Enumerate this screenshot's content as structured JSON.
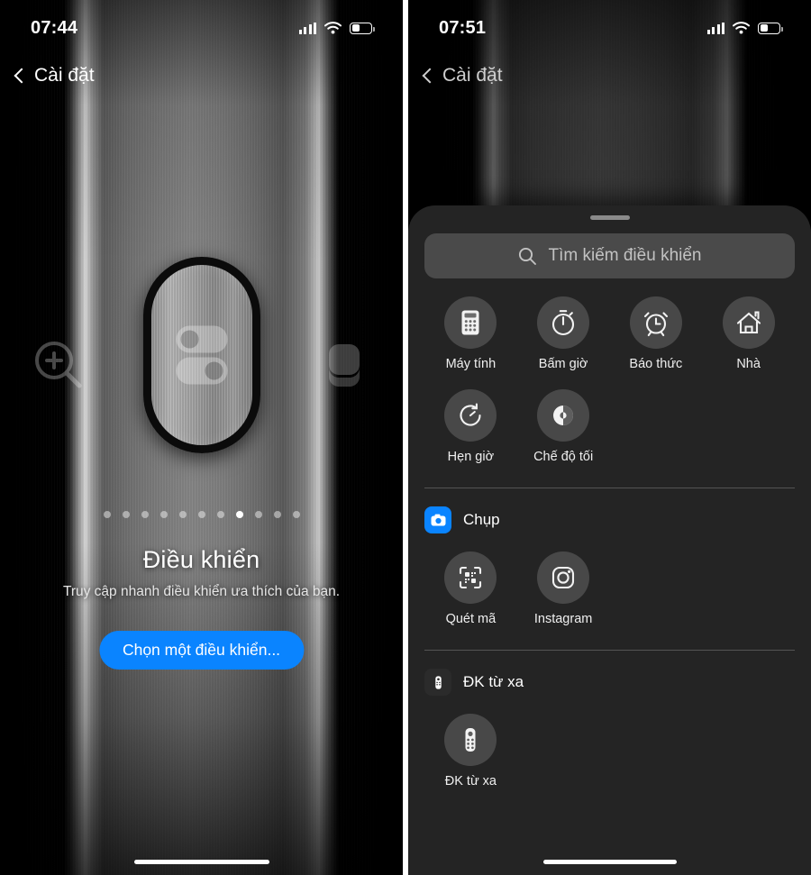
{
  "left": {
    "status": {
      "time": "07:44",
      "signal_icon": "signal-bars-icon",
      "wifi_icon": "wifi-icon",
      "battery_icon": "battery-low-icon"
    },
    "nav": {
      "back_label": "Cài đặt",
      "back_icon": "chevron-left-icon"
    },
    "hero": {
      "capsule_icon": "toggle-switch-icon",
      "left_icon": "zoom-in-icon",
      "right_icon": "layers-icon",
      "title": "Điều khiển",
      "subtitle": "Truy cập nhanh điều khiển ưa thích của bạn.",
      "button_label": "Chọn một điều khiển...",
      "page_dots_total": 11,
      "page_dot_active_index": 7
    }
  },
  "right": {
    "status": {
      "time": "07:51",
      "signal_icon": "signal-bars-icon",
      "wifi_icon": "wifi-icon",
      "battery_icon": "battery-low-icon"
    },
    "nav": {
      "back_label": "Cài đặt",
      "back_icon": "chevron-left-icon"
    },
    "sheet": {
      "grabber": "drag-handle",
      "search": {
        "placeholder": "Tìm kiếm điều khiển",
        "icon": "search-icon"
      },
      "controls": [
        {
          "label": "Máy tính",
          "icon": "calculator-icon"
        },
        {
          "label": "Bấm giờ",
          "icon": "stopwatch-icon"
        },
        {
          "label": "Báo thức",
          "icon": "alarm-clock-icon"
        },
        {
          "label": "Nhà",
          "icon": "home-icon"
        },
        {
          "label": "Hẹn giờ",
          "icon": "timer-icon"
        },
        {
          "label": "Chế độ tối",
          "icon": "dark-mode-icon"
        }
      ],
      "sections": [
        {
          "name": "Chụp",
          "app_icon": "camera-app-icon",
          "items": [
            {
              "label": "Quét mã",
              "icon": "qr-scan-icon"
            },
            {
              "label": "Instagram",
              "icon": "instagram-icon"
            }
          ]
        },
        {
          "name": "ĐK từ xa",
          "app_icon": "remote-app-icon",
          "items": [
            {
              "label": "ĐK từ xa",
              "icon": "remote-control-icon"
            }
          ]
        }
      ]
    }
  },
  "colors": {
    "accent": "#0a84ff",
    "sheet_bg": "#242424",
    "bubble": "rgba(255,255,255,0.17)"
  }
}
